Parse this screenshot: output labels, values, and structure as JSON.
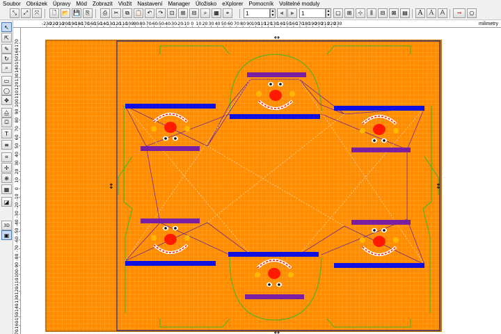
{
  "menu": [
    {
      "id": "soubor",
      "label": "Soubor"
    },
    {
      "id": "obrazek",
      "label": "Obrázek"
    },
    {
      "id": "upravy",
      "label": "Úpravy"
    },
    {
      "id": "mod",
      "label": "Mód"
    },
    {
      "id": "zobrazit",
      "label": "Zobrazit"
    },
    {
      "id": "vlozit",
      "label": "Vložit"
    },
    {
      "id": "nastaveni",
      "label": "Nastavení"
    },
    {
      "id": "manager",
      "label": "Manager"
    },
    {
      "id": "uloziste",
      "label": "Úložisko"
    },
    {
      "id": "explorer",
      "label": "eXplorer"
    },
    {
      "id": "pomocnik",
      "label": "Pomocník"
    },
    {
      "id": "volitelne",
      "label": "Volitelné moduly"
    }
  ],
  "toolbar": {
    "field1_value": "1",
    "field2_value": "1",
    "font_a_label": "A",
    "font_a2_label": "A",
    "text_a_label": "A"
  },
  "ruler": {
    "units": "milimetry",
    "h_ticks": [
      "-230",
      "-220",
      "-210",
      "-200",
      "-190",
      "-180",
      "-170",
      "-160",
      "-150",
      "-140",
      "-130",
      "-120",
      "-110",
      "-100",
      "-90",
      "-80",
      "-70",
      "-60",
      "-50",
      "-40",
      "-30",
      "-20",
      "-10",
      "0",
      "10",
      "20",
      "30",
      "40",
      "50",
      "60",
      "70",
      "80",
      "90",
      "100",
      "110",
      "120",
      "130",
      "140",
      "150",
      "160",
      "170",
      "180",
      "190",
      "200",
      "210",
      "220",
      "230"
    ],
    "v_ticks": [
      "170",
      "160",
      "150",
      "140",
      "130",
      "120",
      "110",
      "100",
      "90",
      "80",
      "70",
      "60",
      "50",
      "40",
      "30",
      "20",
      "10",
      "0",
      "-10",
      "-20",
      "-30",
      "-40",
      "-50",
      "-60",
      "-70",
      "-80",
      "-90",
      "-100",
      "-110",
      "-120",
      "-130",
      "-140",
      "-150",
      "-160",
      "-170"
    ]
  },
  "left_tools": [
    {
      "id": "select",
      "icon": "arrow-pointer-icon",
      "glyph": "↖",
      "active": true
    },
    {
      "id": "node-edit",
      "icon": "node-arrow-icon",
      "glyph": "⇱",
      "active": false
    },
    {
      "id": "pencil",
      "icon": "pencil-icon",
      "glyph": "✎",
      "active": false
    },
    {
      "id": "rotate",
      "icon": "rotate-icon",
      "glyph": "↻",
      "active": false
    },
    {
      "id": "zoom",
      "icon": "magnifier-icon",
      "glyph": "⌕",
      "active": false
    },
    {
      "id": "rectangle",
      "icon": "rectangle-icon",
      "glyph": "▭",
      "active": false
    },
    {
      "id": "ellipse",
      "icon": "ellipse-icon",
      "glyph": "◯",
      "active": false
    },
    {
      "id": "move",
      "icon": "move-cross-icon",
      "glyph": "✥",
      "active": false
    },
    {
      "id": "mirror",
      "icon": "mirror-icon",
      "glyph": "⧋",
      "active": false
    },
    {
      "id": "fill",
      "icon": "bucket-icon",
      "glyph": "⛋",
      "active": false
    },
    {
      "id": "text",
      "icon": "text-icon",
      "glyph": "T",
      "active": false
    },
    {
      "id": "align",
      "icon": "align-icon",
      "glyph": "≡",
      "active": false
    },
    {
      "id": "crop",
      "icon": "crop-icon",
      "glyph": "⌗",
      "active": false
    },
    {
      "id": "drag",
      "icon": "drag-icon",
      "glyph": "✢",
      "active": false
    },
    {
      "id": "weld",
      "icon": "weld-icon",
      "glyph": "⊕",
      "active": false
    },
    {
      "id": "layers",
      "icon": "layers-icon",
      "glyph": "▦",
      "active": false
    },
    {
      "id": "shadow",
      "icon": "shadow-icon",
      "glyph": "◪",
      "active": false
    },
    {
      "id": "3d",
      "icon": "3d-icon",
      "glyph": "3D",
      "active": false
    },
    {
      "id": "preview",
      "icon": "preview-icon",
      "glyph": "▣",
      "active": true
    }
  ],
  "canvas": {
    "background": "#ffffff",
    "artboard_fill": "#ff8c00",
    "grid_color": "#ffb040",
    "bar_blue": "#1010e0",
    "bar_purple": "#7a1fa2",
    "outline_green": "#60b020",
    "clown_red": "#ff1a00",
    "clown_white": "#ffffff",
    "clown_yellow": "#ffb800"
  }
}
